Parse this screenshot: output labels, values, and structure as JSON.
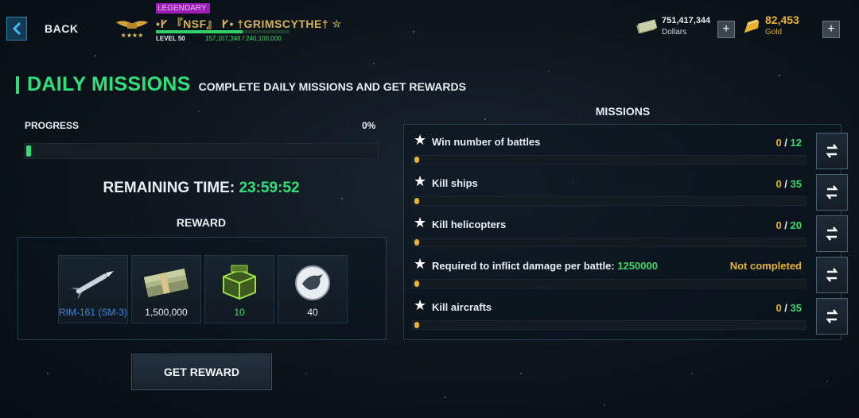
{
  "topbar": {
    "back_label": "BACK",
    "rank_badge": "LEGENDARY",
    "player_name": "•𐌖 『NSF』 𐌖• †GRIMSCYTHE† ✮",
    "level": "LEVEL 50",
    "xp": "157,107,348 / 240,100,000",
    "xp_progress": 0.65,
    "dollars_value": "751,417,344",
    "dollars_label": "Dollars",
    "gold_value": "82,453",
    "gold_label": "Gold",
    "plus": "+"
  },
  "heading": {
    "title": "DAILY MISSIONS",
    "subtitle": "COMPLETE DAILY MISSIONS AND GET REWARDS"
  },
  "progress": {
    "label": "PROGRESS",
    "percent": "0%",
    "remaining_label": "REMAINING TIME: ",
    "remaining_time": "23:59:52"
  },
  "reward": {
    "label": "REWARD",
    "items": [
      {
        "icon": "missile-icon",
        "label": "RIM-161 (SM-3)",
        "color": "#3d8be0"
      },
      {
        "icon": "cash-stack-icon",
        "label": "1,500,000",
        "color": "#e6eef5"
      },
      {
        "icon": "supply-crate-icon",
        "label": "10",
        "color": "#3fd76f"
      },
      {
        "icon": "eagle-emblem-icon",
        "label": "40",
        "color": "#e6eef5"
      }
    ],
    "button": "GET REWARD"
  },
  "missions": {
    "title": "MISSIONS",
    "list": [
      {
        "name": "Win number of battles",
        "current": "0",
        "sep": " / ",
        "total": "12"
      },
      {
        "name": "Kill ships",
        "current": "0",
        "sep": " / ",
        "total": "35"
      },
      {
        "name": "Kill helicopters",
        "current": "0",
        "sep": " / ",
        "total": "20"
      },
      {
        "name": "Required to inflict damage per battle: ",
        "target": "1250000",
        "status": "Not completed"
      },
      {
        "name": "Kill aircrafts",
        "current": "0",
        "sep": " / ",
        "total": "35"
      }
    ]
  }
}
